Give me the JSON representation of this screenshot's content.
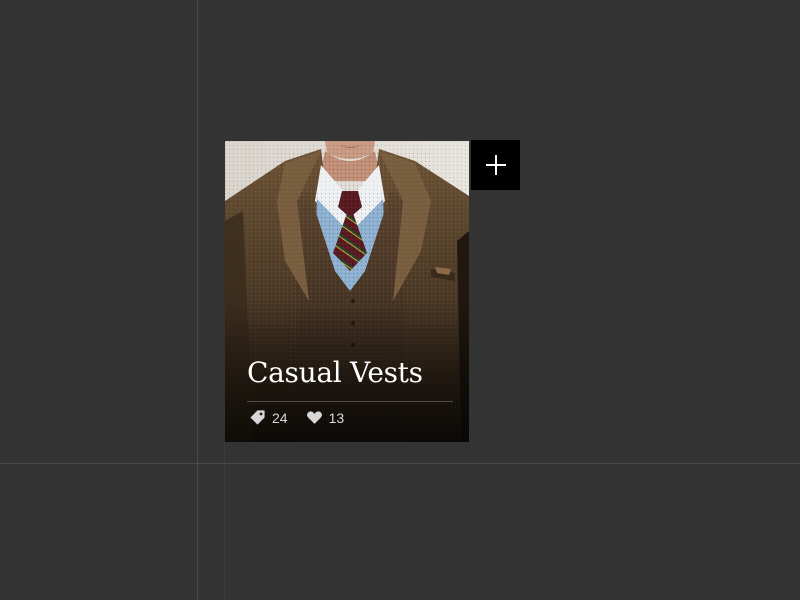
{
  "card": {
    "title": "Casual Vests",
    "tags_count": "24",
    "likes_count": "13",
    "image_subject": "man in brown tweed jacket and vest with striped tie"
  },
  "add_button": {
    "icon": "plus-icon"
  },
  "colors": {
    "background": "#333333",
    "add_button_bg": "#000000",
    "title_text": "#ffffff",
    "stat_text": "#d8d8d8"
  }
}
